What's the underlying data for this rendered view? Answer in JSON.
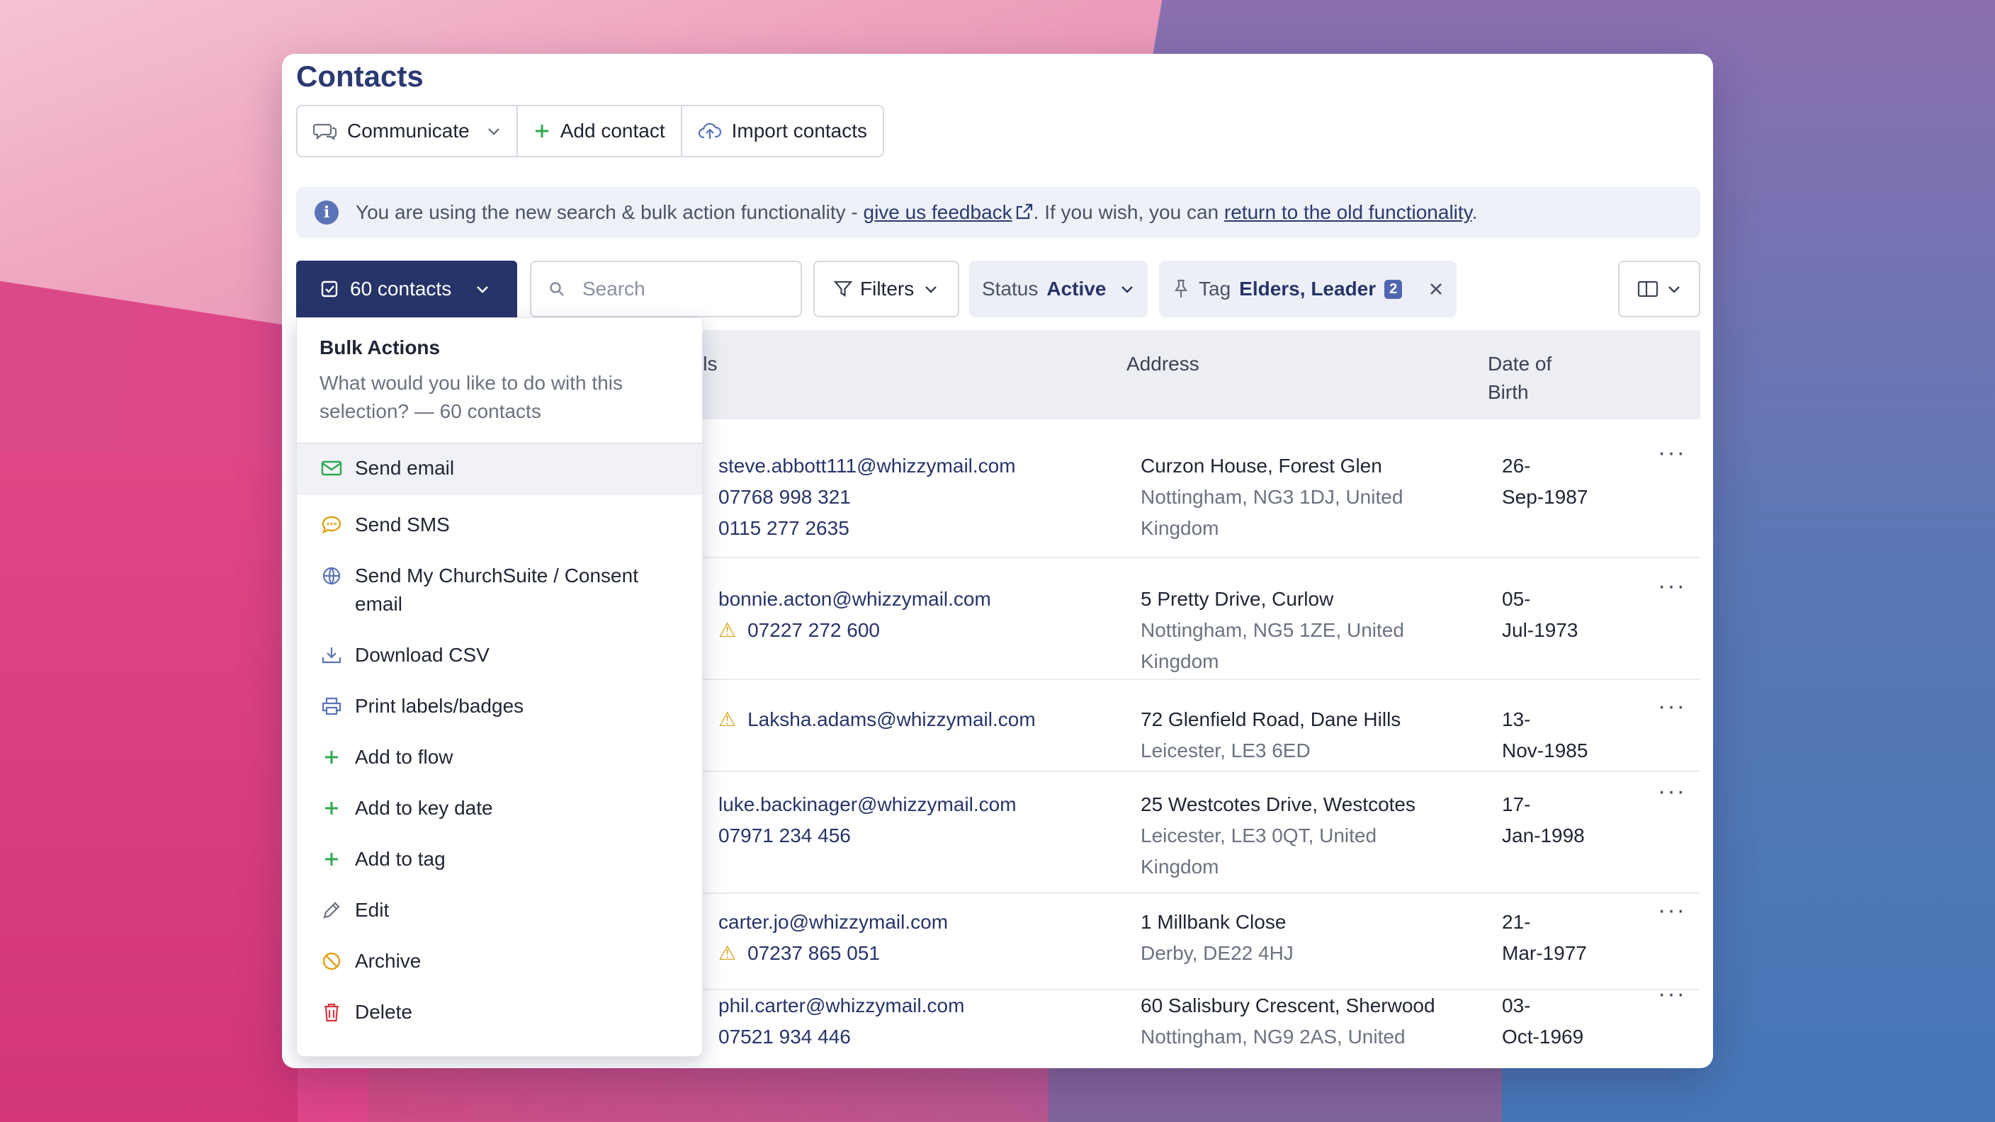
{
  "page": {
    "title": "Contacts"
  },
  "actions": {
    "communicate": "Communicate",
    "add_contact": "Add contact",
    "import_contacts": "Import contacts"
  },
  "banner": {
    "prefix": "You are using the new search & bulk action functionality - ",
    "feedback_link": "give us feedback",
    "middle": ". If you wish, you can ",
    "old_link": "return to the old functionality",
    "suffix": "."
  },
  "toolbar": {
    "selection_label": "60 contacts",
    "search_placeholder": "Search",
    "filters_label": "Filters",
    "status_key": "Status",
    "status_value": "Active",
    "tag_key": "Tag",
    "tag_value": "Elders, Leader",
    "tag_count": "2"
  },
  "table": {
    "headers": {
      "details_partial": "ils",
      "address": "Address",
      "dob_line1": "Date of",
      "dob_line2": "Birth"
    },
    "rows": [
      {
        "emails": [
          "steve.abbott111@whizzymail.com",
          "07768 998 321",
          "0115 277 2635"
        ],
        "addr1": "Curzon House, Forest Glen",
        "addr2": "Nottingham, NG3 1DJ, United",
        "addr3": "Kingdom",
        "dob1": "26-",
        "dob2": "Sep-1987"
      },
      {
        "emails": [
          "bonnie.acton@whizzymail.com",
          "07227 272 600"
        ],
        "addr1": "5 Pretty Drive, Curlow",
        "addr2": "Nottingham, NG5 1ZE, United",
        "addr3": "Kingdom",
        "dob1": "05-",
        "dob2": "Jul-1973"
      },
      {
        "emails": [
          "Laksha.adams@whizzymail.com"
        ],
        "addr1": "72 Glenfield Road, Dane Hills",
        "addr2": "Leicester, LE3 6ED",
        "addr3": "",
        "dob1": "13-",
        "dob2": "Nov-1985"
      },
      {
        "emails": [
          "luke.backinager@whizzymail.com",
          "07971 234 456"
        ],
        "addr1": "25 Westcotes Drive, Westcotes",
        "addr2": "Leicester, LE3 0QT, United",
        "addr3": "Kingdom",
        "dob1": "17-",
        "dob2": "Jan-1998"
      },
      {
        "emails": [
          "carter.jo@whizzymail.com",
          "07237 865 051"
        ],
        "addr1": "1 Millbank Close",
        "addr2": "Derby, DE22 4HJ",
        "addr3": "",
        "dob1": "21-",
        "dob2": "Mar-1977"
      },
      {
        "emails": [
          "phil.carter@whizzymail.com",
          "07521 934 446"
        ],
        "addr1": "60 Salisbury Crescent, Sherwood",
        "addr2": "Nottingham, NG9 2AS, United",
        "addr3": "",
        "dob1": "03-",
        "dob2": "Oct-1969"
      }
    ],
    "row_menu": "···"
  },
  "bulk_actions": {
    "title": "Bulk Actions",
    "description": "What would you like to do with this selection? — 60 contacts",
    "items": [
      {
        "label": "Send email",
        "icon": "envelope-icon"
      },
      {
        "label": "Send SMS",
        "icon": "chat-bubble-icon"
      },
      {
        "label": "Send My ChurchSuite / Consent email",
        "icon": "globe-icon"
      },
      {
        "label": "Download CSV",
        "icon": "download-icon"
      },
      {
        "label": "Print labels/badges",
        "icon": "printer-icon"
      },
      {
        "label": "Add to flow",
        "icon": "plus-icon"
      },
      {
        "label": "Add to key date",
        "icon": "plus-icon"
      },
      {
        "label": "Add to tag",
        "icon": "plus-icon"
      },
      {
        "label": "Edit",
        "icon": "pencil-icon"
      },
      {
        "label": "Archive",
        "icon": "ban-icon"
      },
      {
        "label": "Delete",
        "icon": "trash-icon"
      }
    ]
  },
  "colors": {
    "primary": "#27346a",
    "accent": "#4f67b0",
    "green": "#2fa84f",
    "warning": "#e0a21a",
    "danger": "#d9363e"
  }
}
